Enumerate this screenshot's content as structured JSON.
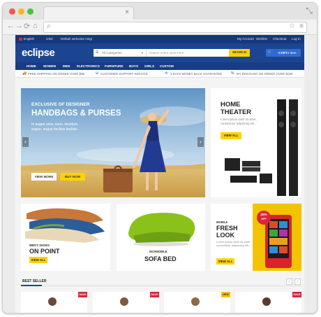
{
  "browser": {
    "tab_close": "×",
    "resize_icon": "⤡",
    "nav": {
      "back": "←",
      "forward": "→",
      "reload": "⟳",
      "home": "⌂"
    },
    "address_search_icon": "⌕",
    "star_icon": "☆",
    "menu_icon": "≡"
  },
  "topbar": {
    "language": "English",
    "currency": "USD",
    "welcome": "Default welcome msg!",
    "links": [
      "My Account",
      "Wishlist",
      "Checkout",
      "Log In"
    ]
  },
  "header": {
    "logo": "eclipse",
    "category_placeholder": "All Categories",
    "search_placeholder": "Search entire store here",
    "search_button": "SEARCH",
    "cart_label": "CART",
    "cart_count": "2 item"
  },
  "menu": [
    "HOME",
    "WOMEN",
    "MEN",
    "ELECTRONICS",
    "FURNITURE",
    "BOYS",
    "GIRLS",
    "CUSTOM"
  ],
  "info": [
    "FREE SHIPPING ON ORDER OVER $99",
    "CUSTOMER SUPPORT SERVICE",
    "3 DAYS MONEY BACK GUARANTEE",
    "5% DISCOUNT ON ORDER OVER $199"
  ],
  "hero": {
    "line1": "EXCLUSIVE OF DESIGNER",
    "line2": "HANDBAGS & PURSES",
    "text": "In augue urna, nunc, tincidunt, augue, augue facilisis facilisis.",
    "view_more": "VIEW MORE",
    "buy_now": "BUY NOW"
  },
  "home_theater": {
    "title1": "HOME",
    "title2": "THEATER",
    "desc": "Lorem ipsum dolor sit amet, consectetur adipiscing elit.",
    "button": "VIEW ALL"
  },
  "shoes": {
    "small": "MEN'S SHOES",
    "big": "ON POINT",
    "button": "VIEW ALL"
  },
  "sofa": {
    "small": "INCREDIBLE",
    "big": "SOFA BED"
  },
  "mobile": {
    "small": "MOBILE",
    "big1": "FRESH",
    "big2": "LOOK",
    "desc": "Lorem ipsum dolor sit amet, consectetur adipiscing elit.",
    "badge_pct": "25%",
    "badge_off": "OFF",
    "button": "VIEW ALL"
  },
  "best_seller": {
    "title": "BEST SELLER",
    "prev": "‹",
    "next": "›",
    "badges": [
      "SALE",
      "SALE",
      "NEW",
      "SALE"
    ]
  },
  "colors": {
    "navy": "#1c4591",
    "yellow": "#ffd200",
    "sale_red": "#d7263d",
    "new_yellow": "#f4c20d"
  }
}
